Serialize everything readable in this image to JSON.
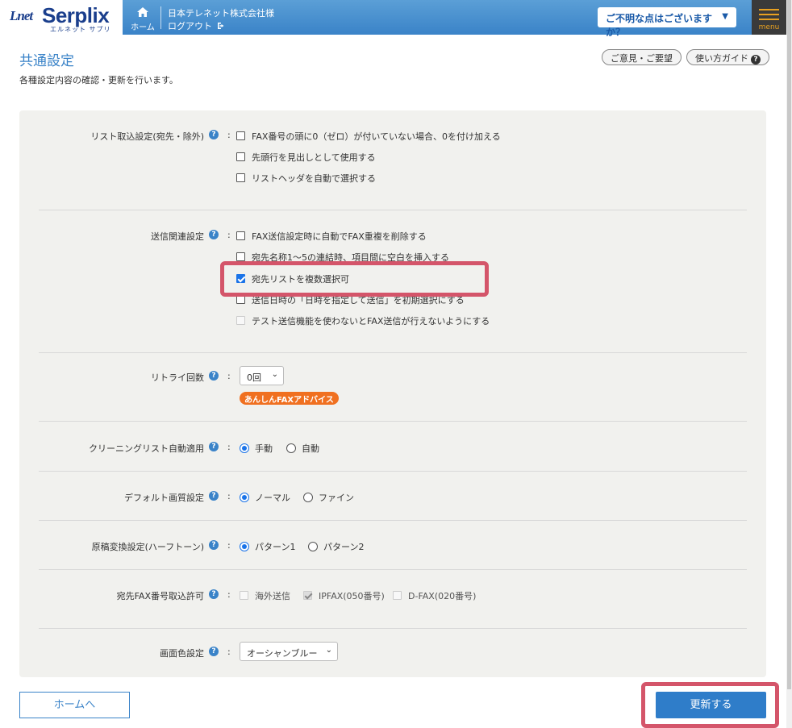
{
  "header": {
    "logo_lnet": "Lnet",
    "logo_name": "Serplix",
    "logo_sub": "エルネット サプリ",
    "home_label": "ホーム",
    "company": "日本テレネット株式会社様",
    "logout": "ログアウト",
    "help_dropdown": "ご不明な点はございますか？",
    "menu_label": "menu"
  },
  "page": {
    "title": "共通設定",
    "description": "各種設定内容の確認・更新を行います。",
    "feedback_button": "ご意見・ご要望",
    "guide_button": "使い方ガイド"
  },
  "settings": {
    "list_import": {
      "label": "リスト取込設定(宛先・除外)",
      "options": [
        {
          "text": "FAX番号の頭に0（ゼロ）が付いていない場合、0を付け加える",
          "checked": false
        },
        {
          "text": "先頭行を見出しとして使用する",
          "checked": false
        },
        {
          "text": "リストヘッダを自動で選択する",
          "checked": false
        }
      ]
    },
    "send": {
      "label": "送信関連設定",
      "options": [
        {
          "text": "FAX送信設定時に自動でFAX重複を削除する",
          "checked": false
        },
        {
          "text": "宛先名称1～5の連結時、項目間に空白を挿入する",
          "checked": false
        },
        {
          "text": "宛先リストを複数選択可",
          "checked": true
        },
        {
          "text": "送信日時の「日時を指定して送信」を初期選択にする",
          "checked": false
        },
        {
          "text": "テスト送信機能を使わないとFAX送信が行えないようにする",
          "checked": false
        }
      ]
    },
    "retry": {
      "label": "リトライ回数",
      "value": "0回",
      "advice": "あんしんFAXアドバイス"
    },
    "cleaning": {
      "label": "クリーニングリスト自動適用",
      "options": [
        "手動",
        "自動"
      ],
      "selected": "手動"
    },
    "quality": {
      "label": "デフォルト画質設定",
      "options": [
        "ノーマル",
        "ファイン"
      ],
      "selected": "ノーマル"
    },
    "halftone": {
      "label": "原稿変換設定(ハーフトーン)",
      "options": [
        "パターン1",
        "パターン2"
      ],
      "selected": "パターン1"
    },
    "fax_number": {
      "label": "宛先FAX番号取込許可",
      "options": [
        {
          "text": "海外送信",
          "checked": false
        },
        {
          "text": "IPFAX(050番号)",
          "checked": true
        },
        {
          "text": "D-FAX(020番号)",
          "checked": false
        }
      ]
    },
    "screen_color": {
      "label": "画面色設定",
      "value": "オーシャンブルー"
    }
  },
  "footer": {
    "home_button": "ホームへ",
    "update_button": "更新する"
  },
  "colors": {
    "accent": "#3a83c8",
    "highlight": "#d4556a",
    "advice": "#f07020"
  }
}
